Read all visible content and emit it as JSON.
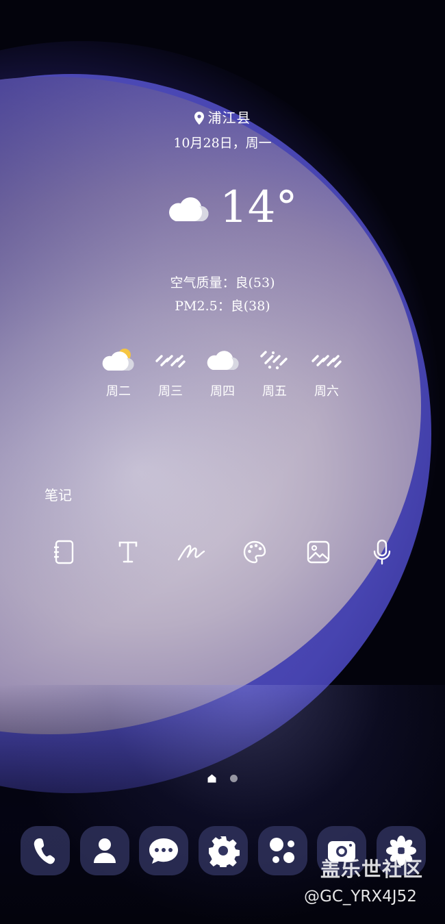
{
  "weather": {
    "location": "浦江县",
    "date": "10月28日，周一",
    "temperature": "14°",
    "condition_icon": "cloudy-icon",
    "air_quality": "空气质量：良(53)",
    "pm25": "PM2.5：良(38)",
    "forecast": [
      {
        "day": "周二",
        "icon": "partly-sunny-icon"
      },
      {
        "day": "周三",
        "icon": "rain-icon"
      },
      {
        "day": "周四",
        "icon": "cloudy-icon"
      },
      {
        "day": "周五",
        "icon": "sleet-icon"
      },
      {
        "day": "周六",
        "icon": "rain-icon"
      }
    ]
  },
  "notes_widget": {
    "title": "笔记",
    "actions": [
      "notebook-icon",
      "text-icon",
      "handwriting-icon",
      "palette-icon",
      "image-icon",
      "microphone-icon"
    ]
  },
  "page_indicator": {
    "current": 1,
    "total": 2
  },
  "dock": [
    "phone-icon",
    "contacts-icon",
    "messages-icon",
    "settings-icon",
    "assistant-icon",
    "camera-icon",
    "gallery-icon"
  ],
  "watermark": {
    "line1": "盖乐世社区",
    "line2": "@GC_YRX4J52"
  }
}
